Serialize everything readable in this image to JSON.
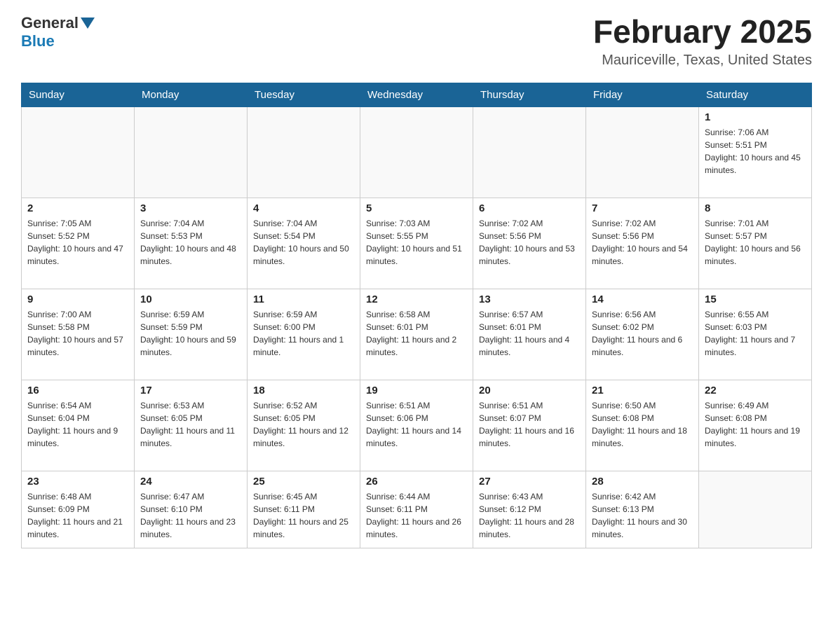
{
  "header": {
    "logo_general": "General",
    "logo_blue": "Blue",
    "main_title": "February 2025",
    "subtitle": "Mauriceville, Texas, United States"
  },
  "days_of_week": [
    "Sunday",
    "Monday",
    "Tuesday",
    "Wednesday",
    "Thursday",
    "Friday",
    "Saturday"
  ],
  "weeks": [
    {
      "days": [
        {
          "date": "",
          "info": ""
        },
        {
          "date": "",
          "info": ""
        },
        {
          "date": "",
          "info": ""
        },
        {
          "date": "",
          "info": ""
        },
        {
          "date": "",
          "info": ""
        },
        {
          "date": "",
          "info": ""
        },
        {
          "date": "1",
          "info": "Sunrise: 7:06 AM\nSunset: 5:51 PM\nDaylight: 10 hours and 45 minutes."
        }
      ]
    },
    {
      "days": [
        {
          "date": "2",
          "info": "Sunrise: 7:05 AM\nSunset: 5:52 PM\nDaylight: 10 hours and 47 minutes."
        },
        {
          "date": "3",
          "info": "Sunrise: 7:04 AM\nSunset: 5:53 PM\nDaylight: 10 hours and 48 minutes."
        },
        {
          "date": "4",
          "info": "Sunrise: 7:04 AM\nSunset: 5:54 PM\nDaylight: 10 hours and 50 minutes."
        },
        {
          "date": "5",
          "info": "Sunrise: 7:03 AM\nSunset: 5:55 PM\nDaylight: 10 hours and 51 minutes."
        },
        {
          "date": "6",
          "info": "Sunrise: 7:02 AM\nSunset: 5:56 PM\nDaylight: 10 hours and 53 minutes."
        },
        {
          "date": "7",
          "info": "Sunrise: 7:02 AM\nSunset: 5:56 PM\nDaylight: 10 hours and 54 minutes."
        },
        {
          "date": "8",
          "info": "Sunrise: 7:01 AM\nSunset: 5:57 PM\nDaylight: 10 hours and 56 minutes."
        }
      ]
    },
    {
      "days": [
        {
          "date": "9",
          "info": "Sunrise: 7:00 AM\nSunset: 5:58 PM\nDaylight: 10 hours and 57 minutes."
        },
        {
          "date": "10",
          "info": "Sunrise: 6:59 AM\nSunset: 5:59 PM\nDaylight: 10 hours and 59 minutes."
        },
        {
          "date": "11",
          "info": "Sunrise: 6:59 AM\nSunset: 6:00 PM\nDaylight: 11 hours and 1 minute."
        },
        {
          "date": "12",
          "info": "Sunrise: 6:58 AM\nSunset: 6:01 PM\nDaylight: 11 hours and 2 minutes."
        },
        {
          "date": "13",
          "info": "Sunrise: 6:57 AM\nSunset: 6:01 PM\nDaylight: 11 hours and 4 minutes."
        },
        {
          "date": "14",
          "info": "Sunrise: 6:56 AM\nSunset: 6:02 PM\nDaylight: 11 hours and 6 minutes."
        },
        {
          "date": "15",
          "info": "Sunrise: 6:55 AM\nSunset: 6:03 PM\nDaylight: 11 hours and 7 minutes."
        }
      ]
    },
    {
      "days": [
        {
          "date": "16",
          "info": "Sunrise: 6:54 AM\nSunset: 6:04 PM\nDaylight: 11 hours and 9 minutes."
        },
        {
          "date": "17",
          "info": "Sunrise: 6:53 AM\nSunset: 6:05 PM\nDaylight: 11 hours and 11 minutes."
        },
        {
          "date": "18",
          "info": "Sunrise: 6:52 AM\nSunset: 6:05 PM\nDaylight: 11 hours and 12 minutes."
        },
        {
          "date": "19",
          "info": "Sunrise: 6:51 AM\nSunset: 6:06 PM\nDaylight: 11 hours and 14 minutes."
        },
        {
          "date": "20",
          "info": "Sunrise: 6:51 AM\nSunset: 6:07 PM\nDaylight: 11 hours and 16 minutes."
        },
        {
          "date": "21",
          "info": "Sunrise: 6:50 AM\nSunset: 6:08 PM\nDaylight: 11 hours and 18 minutes."
        },
        {
          "date": "22",
          "info": "Sunrise: 6:49 AM\nSunset: 6:08 PM\nDaylight: 11 hours and 19 minutes."
        }
      ]
    },
    {
      "days": [
        {
          "date": "23",
          "info": "Sunrise: 6:48 AM\nSunset: 6:09 PM\nDaylight: 11 hours and 21 minutes."
        },
        {
          "date": "24",
          "info": "Sunrise: 6:47 AM\nSunset: 6:10 PM\nDaylight: 11 hours and 23 minutes."
        },
        {
          "date": "25",
          "info": "Sunrise: 6:45 AM\nSunset: 6:11 PM\nDaylight: 11 hours and 25 minutes."
        },
        {
          "date": "26",
          "info": "Sunrise: 6:44 AM\nSunset: 6:11 PM\nDaylight: 11 hours and 26 minutes."
        },
        {
          "date": "27",
          "info": "Sunrise: 6:43 AM\nSunset: 6:12 PM\nDaylight: 11 hours and 28 minutes."
        },
        {
          "date": "28",
          "info": "Sunrise: 6:42 AM\nSunset: 6:13 PM\nDaylight: 11 hours and 30 minutes."
        },
        {
          "date": "",
          "info": ""
        }
      ]
    }
  ]
}
